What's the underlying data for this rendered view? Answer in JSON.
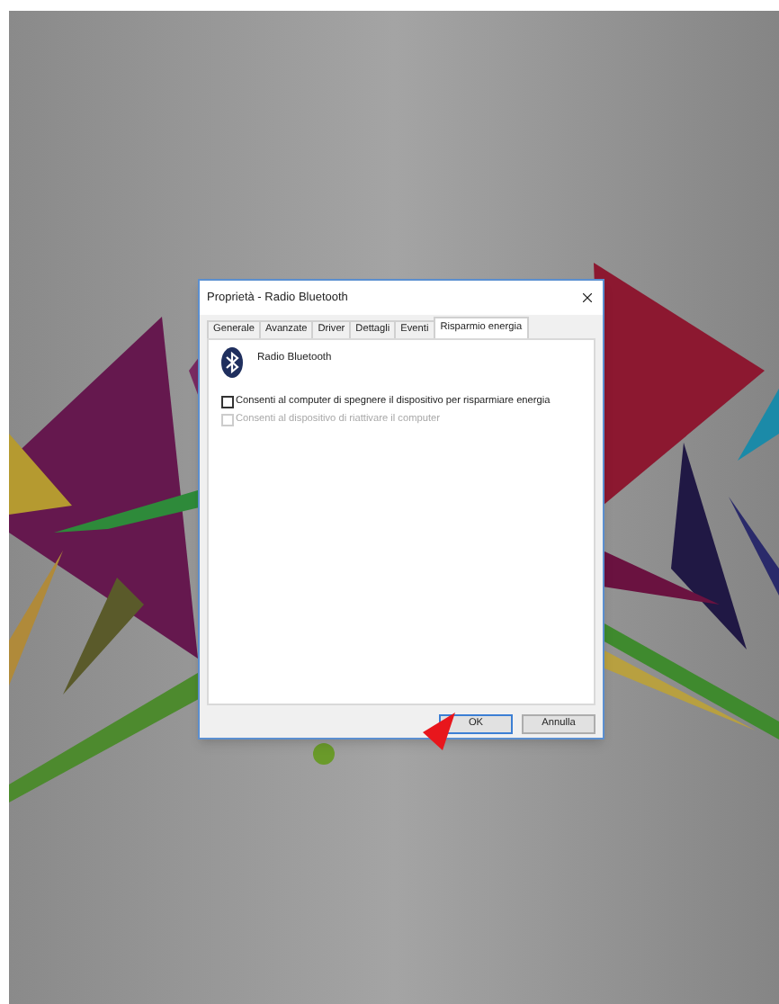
{
  "window": {
    "title": "Proprietà - Radio Bluetooth"
  },
  "tabs": [
    {
      "label": "Generale",
      "selected": false
    },
    {
      "label": "Avanzate",
      "selected": false
    },
    {
      "label": "Driver",
      "selected": false
    },
    {
      "label": "Dettagli",
      "selected": false
    },
    {
      "label": "Eventi",
      "selected": false
    },
    {
      "label": "Risparmio energia",
      "selected": true
    }
  ],
  "device": {
    "name": "Radio Bluetooth"
  },
  "options": [
    {
      "label": "Consenti al computer di spegnere il dispositivo per risparmiare energia",
      "checked": false,
      "disabled": false
    },
    {
      "label": "Consenti al dispositivo di riattivare il computer",
      "checked": false,
      "disabled": true
    }
  ],
  "buttons": [
    {
      "label": "OK",
      "default": true
    },
    {
      "label": "Annulla",
      "default": false
    }
  ]
}
